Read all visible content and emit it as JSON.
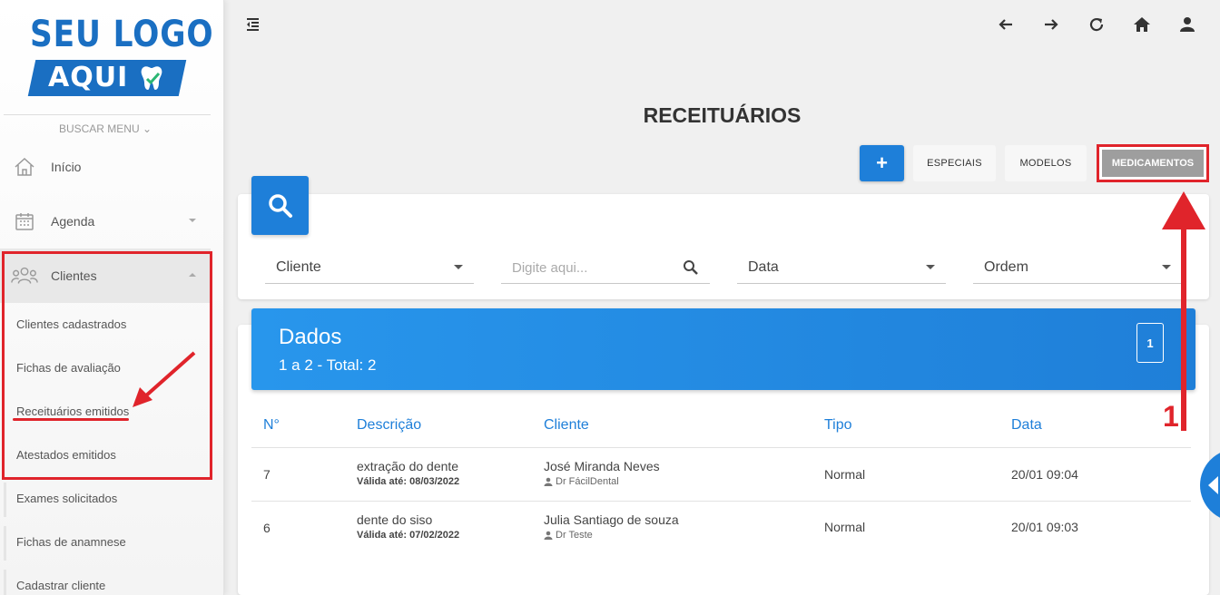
{
  "logo": {
    "line1": "SEU LOGO",
    "line2": "AQUI"
  },
  "sidebar": {
    "search_menu": "BUSCAR MENU ⌄",
    "items": [
      {
        "label": "Início",
        "icon": "home-icon"
      },
      {
        "label": "Agenda",
        "icon": "calendar-icon"
      },
      {
        "label": "Clientes",
        "icon": "users-icon"
      }
    ],
    "subitems": [
      "Clientes cadastrados",
      "Fichas de avaliação",
      "Receituários emitidos",
      "Atestados emitidos",
      "Exames solicitados",
      "Fichas de anamnese",
      "Cadastrar cliente"
    ]
  },
  "page": {
    "title": "RECEITUÁRIOS"
  },
  "actions": {
    "add": "+",
    "especiais": "ESPECIAIS",
    "modelos": "MODELOS",
    "medicamentos": "MEDICAMENTOS"
  },
  "filters": {
    "cliente": "Cliente",
    "search_placeholder": "Digite aqui...",
    "data": "Data",
    "ordem": "Ordem"
  },
  "data_panel": {
    "title": "Dados",
    "subtitle": "1 a 2 - Total: 2",
    "page": "1"
  },
  "table": {
    "headers": [
      "N°",
      "Descrição",
      "Cliente",
      "Tipo",
      "Data"
    ],
    "rows": [
      {
        "num": "7",
        "desc": "extração do dente",
        "valid_label": "Válida até:",
        "valid_date": "08/03/2022",
        "client": "José Miranda Neves",
        "doctor": "Dr FácilDental",
        "tipo": "Normal",
        "data": "20/01 09:04"
      },
      {
        "num": "6",
        "desc": "dente do siso",
        "valid_label": "Válida até:",
        "valid_date": "07/02/2022",
        "client": "Julia Santiago de souza",
        "doctor": "Dr Teste",
        "tipo": "Normal",
        "data": "20/01 09:03"
      }
    ]
  },
  "annotation": {
    "number": "1"
  },
  "colors": {
    "primary": "#1e7fd9",
    "annotation": "#e0242b",
    "button_gray": "#9e9e9e"
  }
}
